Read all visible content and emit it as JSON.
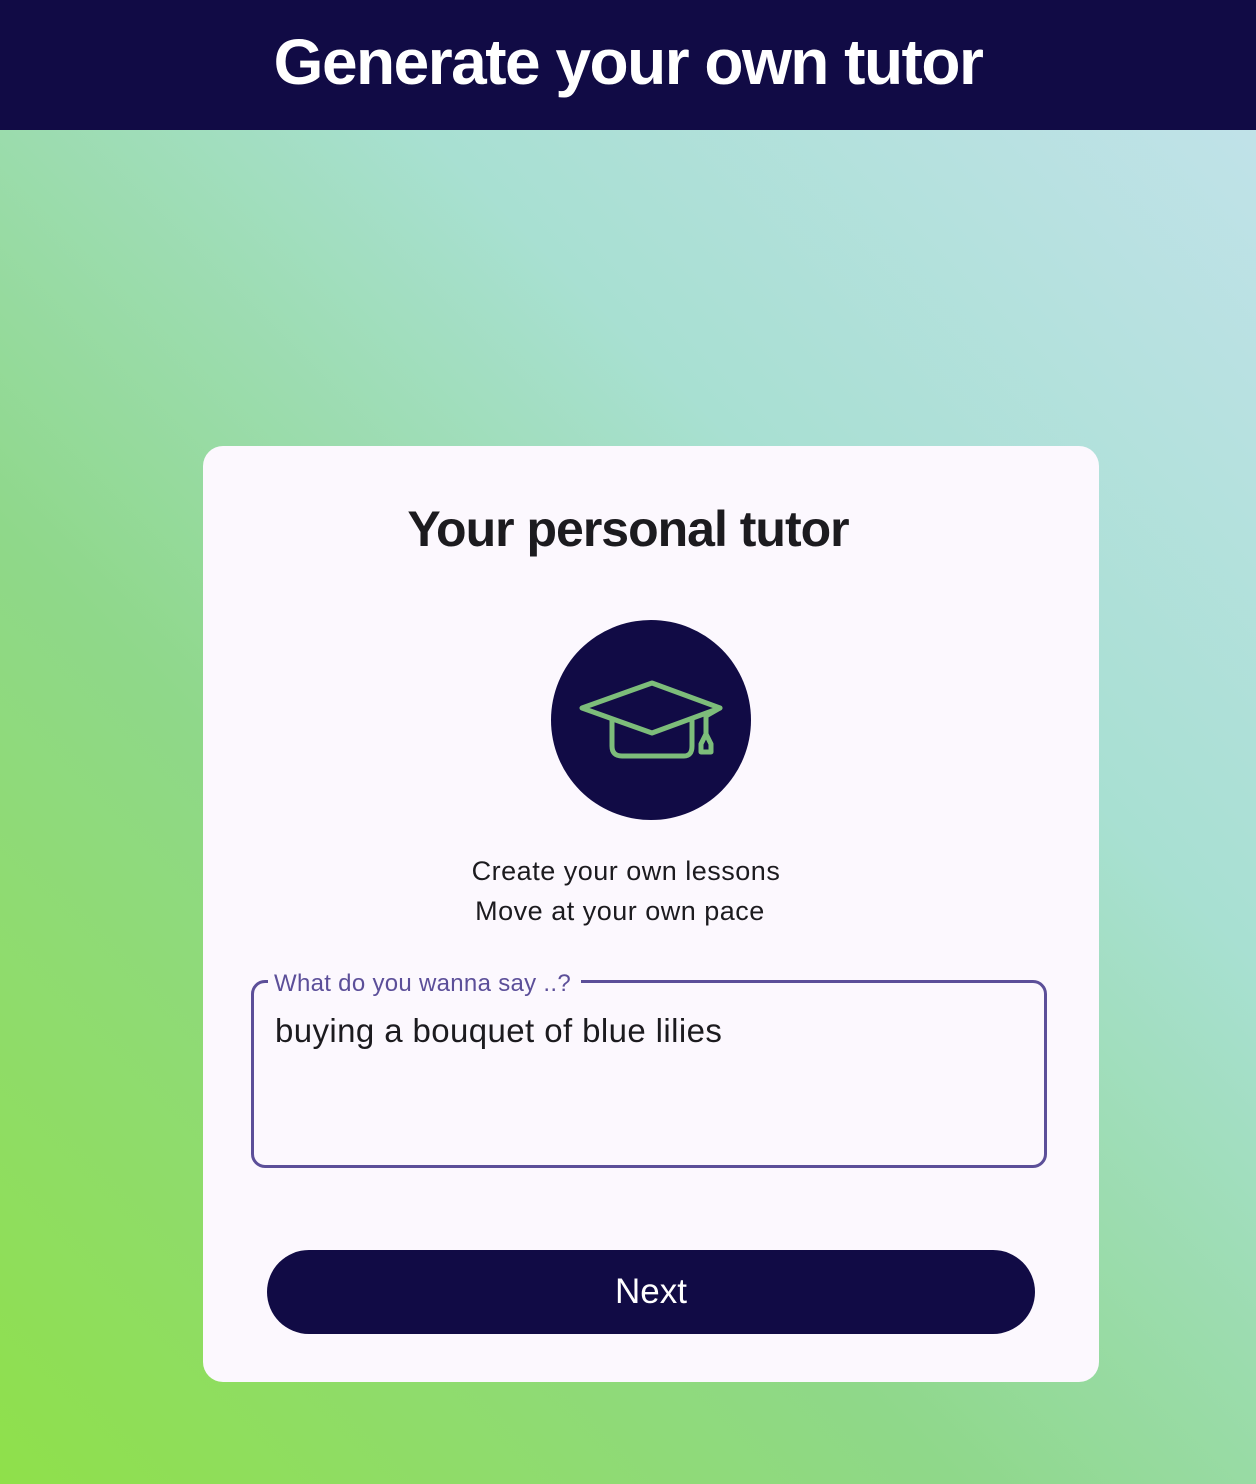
{
  "header": {
    "title": "Generate your own tutor"
  },
  "card": {
    "title": "Your personal tutor",
    "icon": "graduation-cap-icon",
    "tagline_line1": "Create your own lessons",
    "tagline_line2": "Move at your own pace",
    "input": {
      "label": "What do you wanna say ..?",
      "value": "buying a bouquet of blue lilies"
    },
    "next_label": "Next"
  },
  "colors": {
    "header_bg": "#110b45",
    "accent": "#5c4f99",
    "icon_green": "#7dbd7a",
    "card_bg": "#fcf8fe"
  }
}
